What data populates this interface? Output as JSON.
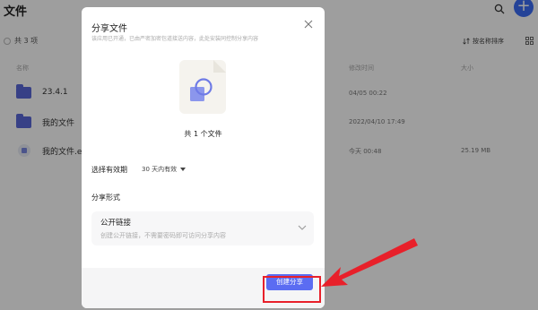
{
  "page": {
    "title": "文件",
    "count": "共 3 项",
    "sort_label": "按名称排序",
    "columns": {
      "name": "名称",
      "modified": "修改时间",
      "size": "大小"
    },
    "rows": [
      {
        "name": "23.4.1",
        "modified": "04/05 00:22",
        "size": "",
        "icon": "folder-icon"
      },
      {
        "name": "我的文件",
        "modified": "2022/04/10 17:49",
        "size": "",
        "icon": "folder-icon"
      },
      {
        "name": "我的文件.e",
        "modified": "今天 00:48",
        "size": "25.19 MB",
        "icon": "file-icon"
      }
    ]
  },
  "modal": {
    "title": "分享文件",
    "subtitle": "该应用已开通，已由严密加密包道接送内容，此处安装同控制分享内容",
    "file_count": "共 1 个文件",
    "expiry_label": "选择有效期",
    "expiry_value": "30 天内有效",
    "share_type_label": "分享形式",
    "option": {
      "title": "公开链接",
      "description": "创建公开链接，不需要密码即可访问分享内容"
    },
    "create_button": "创建分享"
  },
  "colors": {
    "accent": "#5b6cf2",
    "folder": "#5a68d8",
    "annotation": "#e8202a"
  }
}
